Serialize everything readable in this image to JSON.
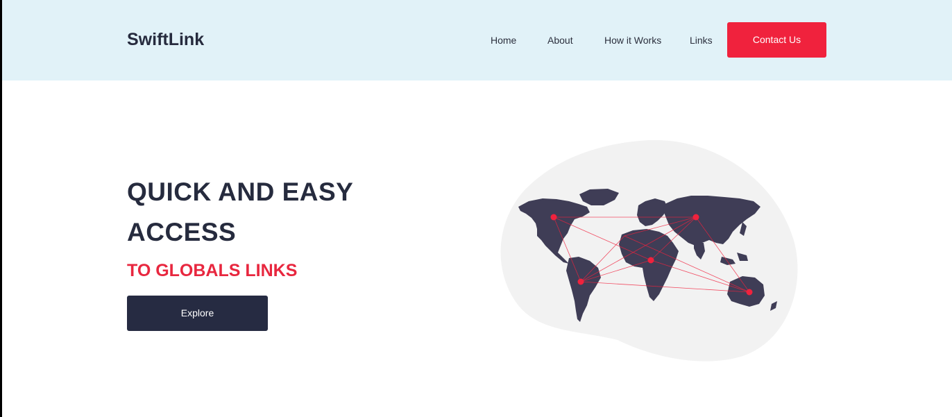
{
  "header": {
    "brand": "SwiftLink",
    "nav": {
      "home": "Home",
      "about": "About",
      "how_it_works": "How it Works",
      "links": "Links"
    },
    "contact_label": "Contact Us"
  },
  "hero": {
    "title": "QUICK AND EASY ACCESS",
    "subtitle": "TO GLOBALS LINKS",
    "cta_label": "Explore"
  },
  "colors": {
    "header_background": "#e1f2f8",
    "primary_dark": "#262b3e",
    "accent_red": "#f0223d",
    "map_land": "#3f3d56",
    "blob": "#f2f2f2"
  },
  "illustration": {
    "icon": "world-map-connections-icon"
  }
}
